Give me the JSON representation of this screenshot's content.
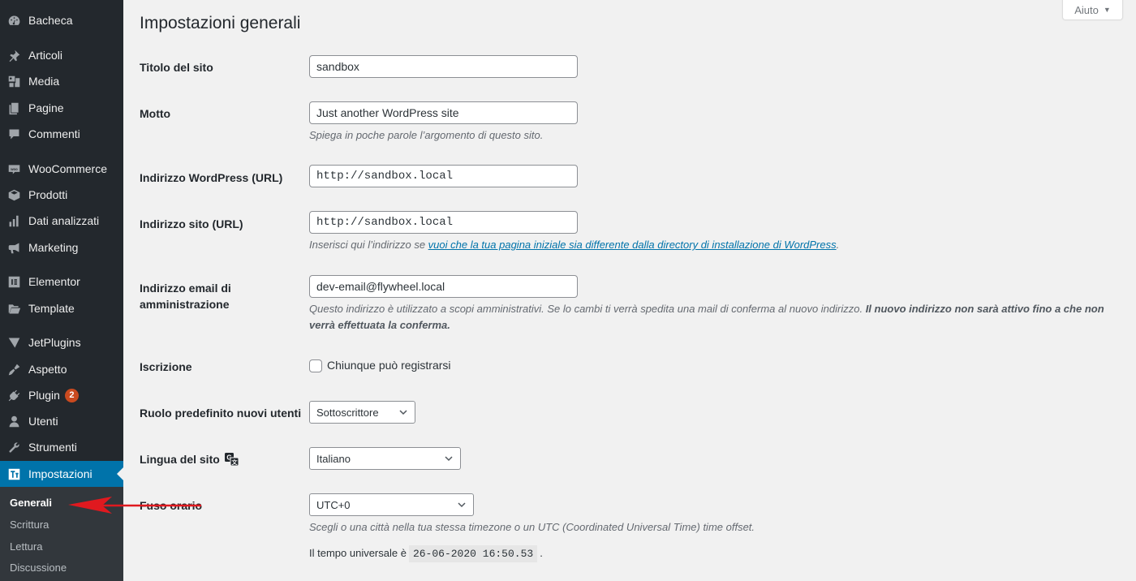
{
  "sidebar": {
    "items": [
      {
        "label": "Bacheca",
        "icon": "dashboard-icon"
      },
      {
        "label": "Articoli",
        "icon": "pin-icon"
      },
      {
        "label": "Media",
        "icon": "media-icon"
      },
      {
        "label": "Pagine",
        "icon": "pages-icon"
      },
      {
        "label": "Commenti",
        "icon": "comment-icon"
      },
      {
        "label": "WooCommerce",
        "icon": "woocommerce-icon"
      },
      {
        "label": "Prodotti",
        "icon": "box-icon"
      },
      {
        "label": "Dati analizzati",
        "icon": "bar-chart-icon"
      },
      {
        "label": "Marketing",
        "icon": "megaphone-icon"
      },
      {
        "label": "Elementor",
        "icon": "elementor-icon"
      },
      {
        "label": "Template",
        "icon": "folder-icon"
      },
      {
        "label": "JetPlugins",
        "icon": "jetplugins-icon"
      },
      {
        "label": "Aspetto",
        "icon": "brush-icon"
      },
      {
        "label": "Plugin",
        "icon": "plugin-icon",
        "badge": "2"
      },
      {
        "label": "Utenti",
        "icon": "user-icon"
      },
      {
        "label": "Strumenti",
        "icon": "wrench-icon"
      },
      {
        "label": "Impostazioni",
        "icon": "settings-icon",
        "active": true
      }
    ],
    "submenu": [
      {
        "label": "Generali",
        "current": true
      },
      {
        "label": "Scrittura"
      },
      {
        "label": "Lettura"
      },
      {
        "label": "Discussione"
      }
    ]
  },
  "help": {
    "label": "Aiuto",
    "arrow": "▼"
  },
  "page": {
    "title": "Impostazioni generali",
    "fields": {
      "site_title": {
        "label": "Titolo del sito",
        "value": "sandbox"
      },
      "tagline": {
        "label": "Motto",
        "value": "Just another WordPress site",
        "description": "Spiega in poche parole l’argomento di questo sito."
      },
      "wp_url": {
        "label": "Indirizzo WordPress (URL)",
        "value": "http://sandbox.local"
      },
      "site_url": {
        "label": "Indirizzo sito (URL)",
        "value": "http://sandbox.local",
        "description_prefix": "Inserisci qui l’indirizzo se ",
        "description_link": "vuoi che la tua pagina iniziale sia differente dalla directory di installazione di WordPress",
        "description_suffix": "."
      },
      "admin_email": {
        "label_line1": "Indirizzo email di",
        "label_line2": "amministrazione",
        "value": "dev-email@flywheel.local",
        "description_normal": "Questo indirizzo è utilizzato a scopi amministrativi. Se lo cambi ti verrà spedita una mail di conferma al nuovo indirizzo. ",
        "description_bold": "Il nuovo indirizzo non sarà attivo fino a che non verrà effettuata la conferma."
      },
      "membership": {
        "label": "Iscrizione",
        "checkbox_label": "Chiunque può registrarsi",
        "checked": false
      },
      "default_role": {
        "label": "Ruolo predefinito nuovi utenti",
        "value": "Sottoscrittore"
      },
      "language": {
        "label": "Lingua del sito",
        "value": "Italiano",
        "icon": "translate-icon"
      },
      "timezone": {
        "label": "Fuso orario",
        "value": "UTC+0",
        "description": "Scegli o una città nella tua stessa timezone o un UTC (Coordinated Universal Time) time offset.",
        "utc_prefix": "Il tempo universale è",
        "utc_time": "26-06-2020 16:50.53",
        "utc_suffix": "."
      }
    }
  },
  "annotation": {
    "color": "#e0191f"
  }
}
